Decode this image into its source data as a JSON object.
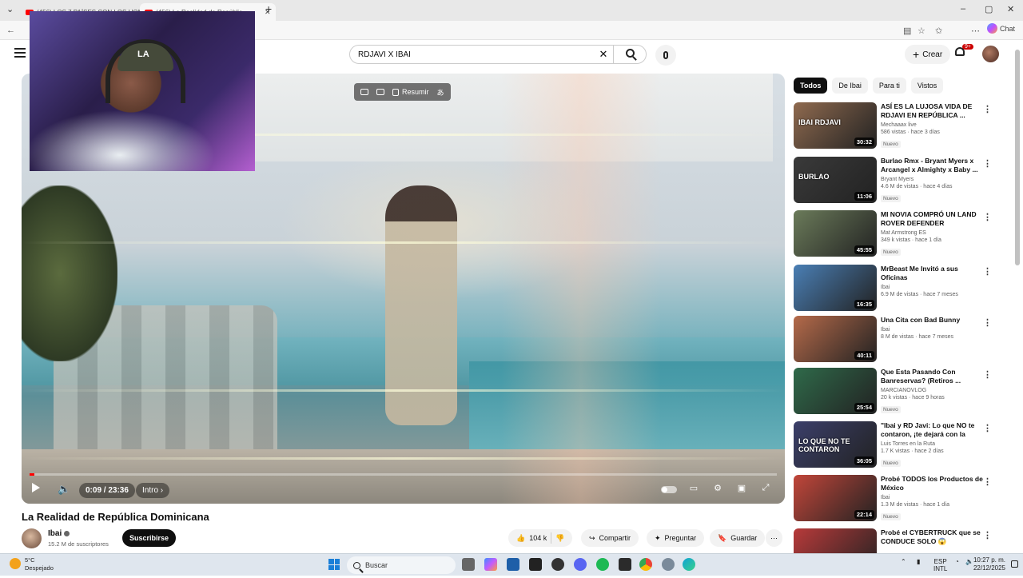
{
  "browser": {
    "tabs": [
      {
        "label": "(456) LOS 7 PAÍSES CON LOS HOM"
      },
      {
        "label": "(456) La Realidad de Repúblic"
      }
    ],
    "chat_label": "Chat"
  },
  "header": {
    "search_value": "RDJAVI X IBAI",
    "create_label": "Crear",
    "notif_count": "9+"
  },
  "player": {
    "summarize_label": "Resumir",
    "time": "0:09 / 23:36",
    "chapter": "Intro",
    "progress_fraction": 0.0064
  },
  "video": {
    "title": "La Realidad de República Dominicana",
    "channel": "Ibai",
    "subscribers": "15.2 M de suscriptores",
    "subscribe_label": "Suscribirse",
    "likes": "104 k",
    "share_label": "Compartir",
    "ask_label": "Preguntar",
    "save_label": "Guardar"
  },
  "sidebar": {
    "chips": [
      "Todos",
      "De Ibai",
      "Para ti",
      "Vistos"
    ],
    "videos": [
      {
        "title": "ASÍ ES LA LUJOSA VIDA DE RDJAVI EN REPÚBLICA ...",
        "channel": "Mechaaax live",
        "meta": "586 vistas · hace 3 días",
        "badge": "Nuevo",
        "duration": "30:32",
        "thumb_color": "#8f6a4f",
        "thumb_text": "IBAI RDJAVI"
      },
      {
        "title": "Burlao Rmx - Bryant Myers x Arcangel x Almighty x Baby ...",
        "channel": "Bryant Myers",
        "meta": "4.6 M de vistas · hace 4 días",
        "badge": "Nuevo",
        "duration": "11:06",
        "thumb_color": "#3a3a3a",
        "thumb_text": "BURLAO"
      },
      {
        "title": "MI NOVIA COMPRÓ UN LAND ROVER DEFENDER DESTRUIDO",
        "channel": "Mat Armstrong ES",
        "meta": "349 k vistas · hace 1 día",
        "badge": "Nuevo",
        "duration": "45:55",
        "thumb_color": "#6b7b5a",
        "thumb_text": ""
      },
      {
        "title": "MrBeast Me Invitó a sus Oficinas",
        "channel": "Ibai",
        "meta": "6.9 M de vistas · hace 7 meses",
        "badge": "",
        "duration": "16:35",
        "thumb_color": "#4a7fb5",
        "thumb_text": ""
      },
      {
        "title": "Una Cita con Bad Bunny",
        "channel": "Ibai",
        "meta": "8 M de vistas · hace 7 meses",
        "badge": "",
        "duration": "40:11",
        "thumb_color": "#b56a4a",
        "thumb_text": ""
      },
      {
        "title": "Que Esta Pasando Con Banreservas? (Retiros ...",
        "channel": "MARCIANOVLOG",
        "meta": "20 k vistas · hace 9 horas",
        "badge": "Nuevo",
        "duration": "25:54",
        "thumb_color": "#2f6a4a",
        "thumb_text": ""
      },
      {
        "title": "\"Ibai y RD Javi: Lo que NO te contaron, ¡te dejará con la boc...",
        "channel": "Luis Torres en la Ruta",
        "meta": "1.7 K vistas · hace 2 días",
        "badge": "Nuevo",
        "duration": "36:05",
        "thumb_color": "#3b3f6a",
        "thumb_text": "LO QUE NO TE CONTARON"
      },
      {
        "title": "Probé TODOS los Productos de México",
        "channel": "Ibai",
        "meta": "1.3 M de vistas · hace 1 día",
        "badge": "Nuevo",
        "duration": "22:14",
        "thumb_color": "#c2463a",
        "thumb_text": ""
      },
      {
        "title": "Probé el CYBERTRUCK que se CONDUCE SOLO 😱",
        "channel": "",
        "meta": "",
        "badge": "",
        "duration": "",
        "thumb_color": "#b83a3a",
        "thumb_text": ""
      }
    ]
  },
  "taskbar": {
    "temp": "5°C",
    "weather": "Despejado",
    "search_placeholder": "Buscar",
    "lang1": "ESP",
    "lang2": "INTL",
    "time": "10:27 p. m.",
    "date": "22/12/2025"
  }
}
